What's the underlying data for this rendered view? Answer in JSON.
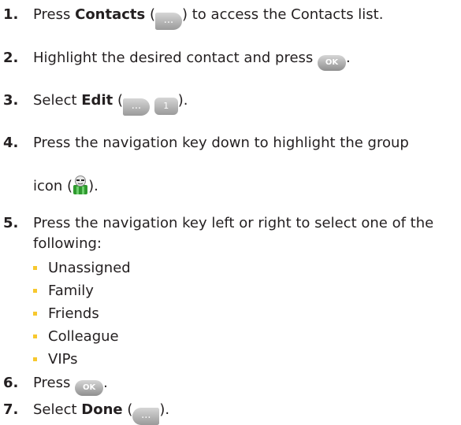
{
  "steps": [
    {
      "num": "1.",
      "pre": "Press ",
      "bold": "Contacts",
      "mid": " (",
      "icon": "right-softkey",
      "icon_text": "...",
      "post": ") to access the Contacts list."
    },
    {
      "num": "2.",
      "text": "Highlight the desired contact and press ",
      "icon": "ok-key",
      "icon_text": "OK",
      "post": "."
    },
    {
      "num": "3.",
      "pre": "Select ",
      "bold": "Edit",
      "mid": " (",
      "icon": "right-softkey",
      "icon_text": "...",
      "icon2": "number-key-1",
      "icon2_text": "1",
      "post": ")."
    },
    {
      "num": "4.",
      "text": "Press the navigation key down to highlight the group",
      "line2_pre": "icon (",
      "icon": "group-icon",
      "post": ")."
    },
    {
      "num": "5.",
      "text": "Press the navigation key left or right to select one of the",
      "line2": "following:"
    },
    {
      "num": "6.",
      "pre": "Press ",
      "icon": "ok-key",
      "icon_text": "OK",
      "post": "."
    },
    {
      "num": "7.",
      "pre": "Select ",
      "bold": "Done",
      "mid": " (",
      "icon": "left-softkey",
      "icon_text": "...",
      "post": ")."
    }
  ],
  "group_options": [
    "Unassigned",
    "Family",
    "Friends",
    "Colleague",
    "VIPs"
  ],
  "colors": {
    "text": "#231f20",
    "bullet": "#f7c82e",
    "key": "#a8a8a8",
    "group_icon_green": "#2f9a2f"
  }
}
